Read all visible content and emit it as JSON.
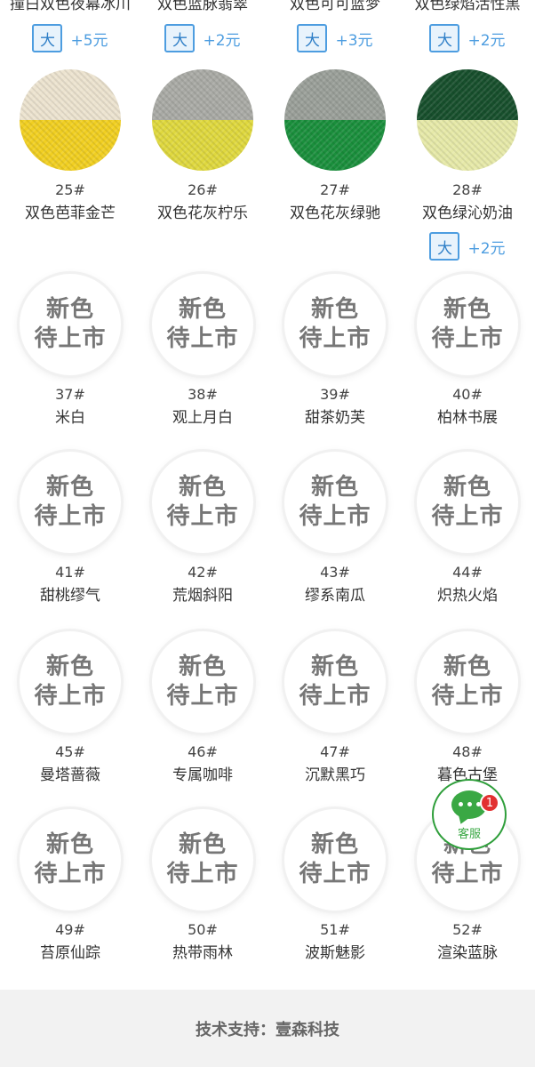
{
  "top_row": [
    {
      "name": "撞白双色夜幕冰川",
      "size_tag": "大",
      "price": "+5元"
    },
    {
      "name": "双色蓝脉翡翠",
      "size_tag": "大",
      "price": "+2元"
    },
    {
      "name": "双色可可蓝梦",
      "size_tag": "大",
      "price": "+3元"
    },
    {
      "name": "双色绿焰活性黑",
      "size_tag": "大",
      "price": "+2元"
    }
  ],
  "swatch_row": [
    {
      "num": "25#",
      "name": "双色芭菲金芒",
      "top_color": "#ece3cf",
      "bottom_color": "#f1cf21"
    },
    {
      "num": "26#",
      "name": "双色花灰柠乐",
      "top_color": "#a9aaa5",
      "bottom_color": "#dfd83e"
    },
    {
      "num": "27#",
      "name": "双色花灰绿驰",
      "top_color": "#9a9f99",
      "bottom_color": "#1a8f3c"
    },
    {
      "num": "28#",
      "name": "双色绿沁奶油",
      "top_color": "#174f2c",
      "bottom_color": "#e6e9a8",
      "size_tag": "大",
      "price": "+2元"
    }
  ],
  "placeholder_text": {
    "line1": "新色",
    "line2": "待上市"
  },
  "upcoming": [
    {
      "num": "37#",
      "name": "米白"
    },
    {
      "num": "38#",
      "name": "观上月白"
    },
    {
      "num": "39#",
      "name": "甜茶奶芙"
    },
    {
      "num": "40#",
      "name": "柏林书展"
    },
    {
      "num": "41#",
      "name": "甜桃缪气"
    },
    {
      "num": "42#",
      "name": "荒烟斜阳"
    },
    {
      "num": "43#",
      "name": "缪系南瓜"
    },
    {
      "num": "44#",
      "name": "炽热火焰"
    },
    {
      "num": "45#",
      "name": "曼塔蔷薇"
    },
    {
      "num": "46#",
      "name": "专属咖啡"
    },
    {
      "num": "47#",
      "name": "沉默黑巧"
    },
    {
      "num": "48#",
      "name": "暮色古堡"
    },
    {
      "num": "49#",
      "name": "苔原仙踪"
    },
    {
      "num": "50#",
      "name": "热带雨林"
    },
    {
      "num": "51#",
      "name": "波斯魅影"
    },
    {
      "num": "52#",
      "name": "渲染蓝脉"
    }
  ],
  "service_button": {
    "label": "客服",
    "badge": "1",
    "icon": "chat-bubble-icon",
    "accent": "#3aa844"
  },
  "footer": {
    "text": "技术支持：壹森科技"
  },
  "colors": {
    "tag_border": "#4d9de0",
    "price": "#4d9de0",
    "footer_bg": "#f2f2f2"
  }
}
